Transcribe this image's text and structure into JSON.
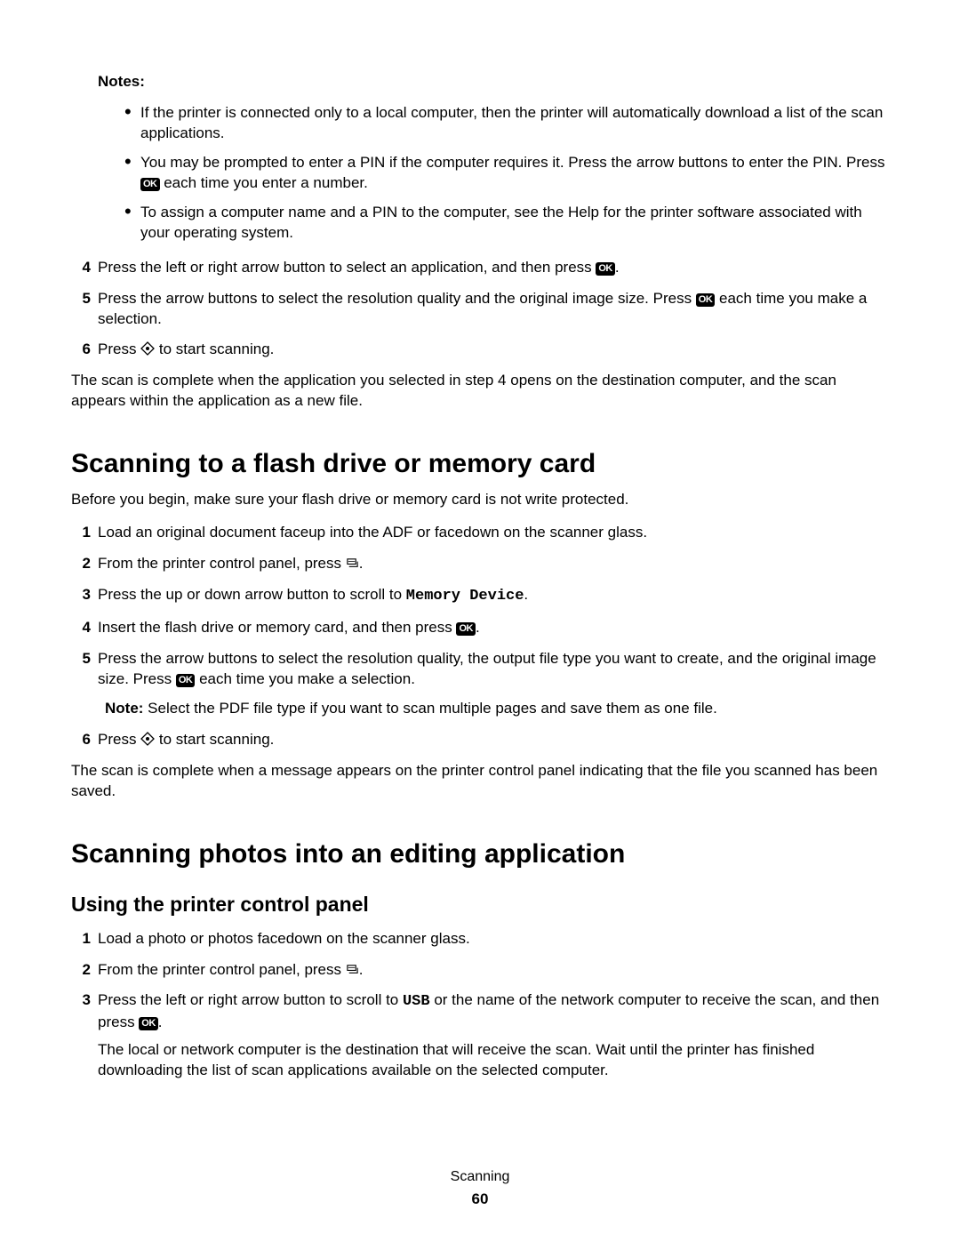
{
  "icons": {
    "ok": "OK"
  },
  "notes_heading": "Notes:",
  "notes_bullets": {
    "b1": "If the printer is connected only to a local computer, then the printer will automatically download a list of the scan applications.",
    "b2_a": "You may be prompted to enter a PIN if the computer requires it. Press the arrow buttons to enter the PIN. Press ",
    "b2_b": " each time you enter a number.",
    "b3": "To assign a computer name and a PIN to the computer, see the Help for the printer software associated with your operating system."
  },
  "cont_steps": {
    "n4": "4",
    "s4_a": "Press the left or right arrow button to select an application, and then press ",
    "s4_b": ".",
    "n5": "5",
    "s5_a": "Press the arrow buttons to select the resolution quality and the original image size. Press ",
    "s5_b": " each time you make a selection.",
    "n6": "6",
    "s6_a": "Press ",
    "s6_b": " to start scanning."
  },
  "cont_para": "The scan is complete when the application you selected in step 4 opens on the destination computer, and the scan appears within the application as a new file.",
  "section1_title": "Scanning to a flash drive or memory card",
  "section1_intro": "Before you begin, make sure your flash drive or memory card is not write protected.",
  "section1_steps": {
    "n1": "1",
    "s1": "Load an original document faceup into the ADF or facedown on the scanner glass.",
    "n2": "2",
    "s2_a": "From the printer control panel, press ",
    "s2_b": ".",
    "n3": "3",
    "s3_a": "Press the up or down arrow button to scroll to ",
    "s3_mono": "Memory Device",
    "s3_b": ".",
    "n4": "4",
    "s4_a": "Insert the flash drive or memory card, and then press ",
    "s4_b": ".",
    "n5": "5",
    "s5_a": "Press the arrow buttons to select the resolution quality, the output file type you want to create, and the original image size. Press ",
    "s5_b": " each time you make a selection.",
    "note_label": "Note: ",
    "note_text": "Select the PDF file type if you want to scan multiple pages and save them as one file.",
    "n6": "6",
    "s6_a": "Press ",
    "s6_b": " to start scanning."
  },
  "section1_outro": "The scan is complete when a message appears on the printer control panel indicating that the file you scanned has been saved.",
  "section2_title": "Scanning photos into an editing application",
  "section2_sub": "Using the printer control panel",
  "section2_steps": {
    "n1": "1",
    "s1": "Load a photo or photos facedown on the scanner glass.",
    "n2": "2",
    "s2_a": "From the printer control panel, press ",
    "s2_b": ".",
    "n3": "3",
    "s3_a": "Press the left or right arrow button to scroll to ",
    "s3_mono": "USB",
    "s3_b": " or the name of the network computer to receive the scan, and then press ",
    "s3_c": ".",
    "s3_para": "The local or network computer is the destination that will receive the scan. Wait until the printer has finished downloading the list of scan applications available on the selected computer."
  },
  "footer": {
    "section": "Scanning",
    "page": "60"
  }
}
